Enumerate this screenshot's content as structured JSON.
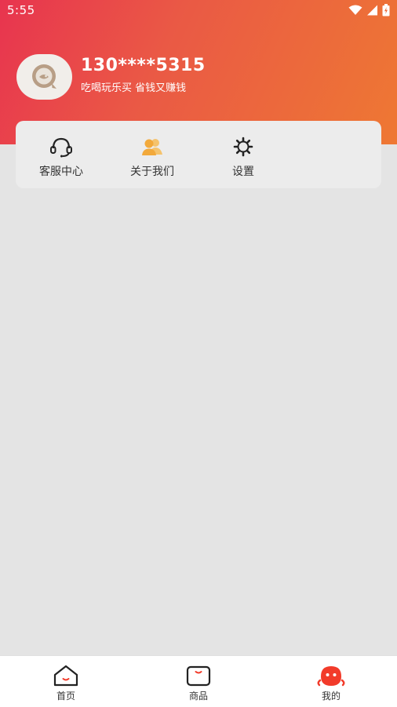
{
  "status_bar": {
    "time": "5:55",
    "icons": [
      "wifi-icon",
      "signal-icon",
      "battery-icon"
    ]
  },
  "profile": {
    "phone": "130****5315",
    "slogan": "吃喝玩乐买 省钱又赚钱",
    "avatar_icon": "app-logo-icon"
  },
  "menu": {
    "items": [
      {
        "label": "客服中心",
        "icon": "headset-icon"
      },
      {
        "label": "关于我们",
        "icon": "users-icon"
      },
      {
        "label": "设置",
        "icon": "gear-icon"
      }
    ]
  },
  "tabbar": {
    "items": [
      {
        "label": "首页",
        "icon": "home-icon",
        "active": false
      },
      {
        "label": "商品",
        "icon": "bag-icon",
        "active": false
      },
      {
        "label": "我的",
        "icon": "profile-icon",
        "active": true
      }
    ]
  },
  "colors": {
    "header_start": "#e8344f",
    "header_end": "#ee7833",
    "accent": "#f23b2a",
    "background": "#e4e4e4",
    "users_icon": "#f2b54a"
  }
}
